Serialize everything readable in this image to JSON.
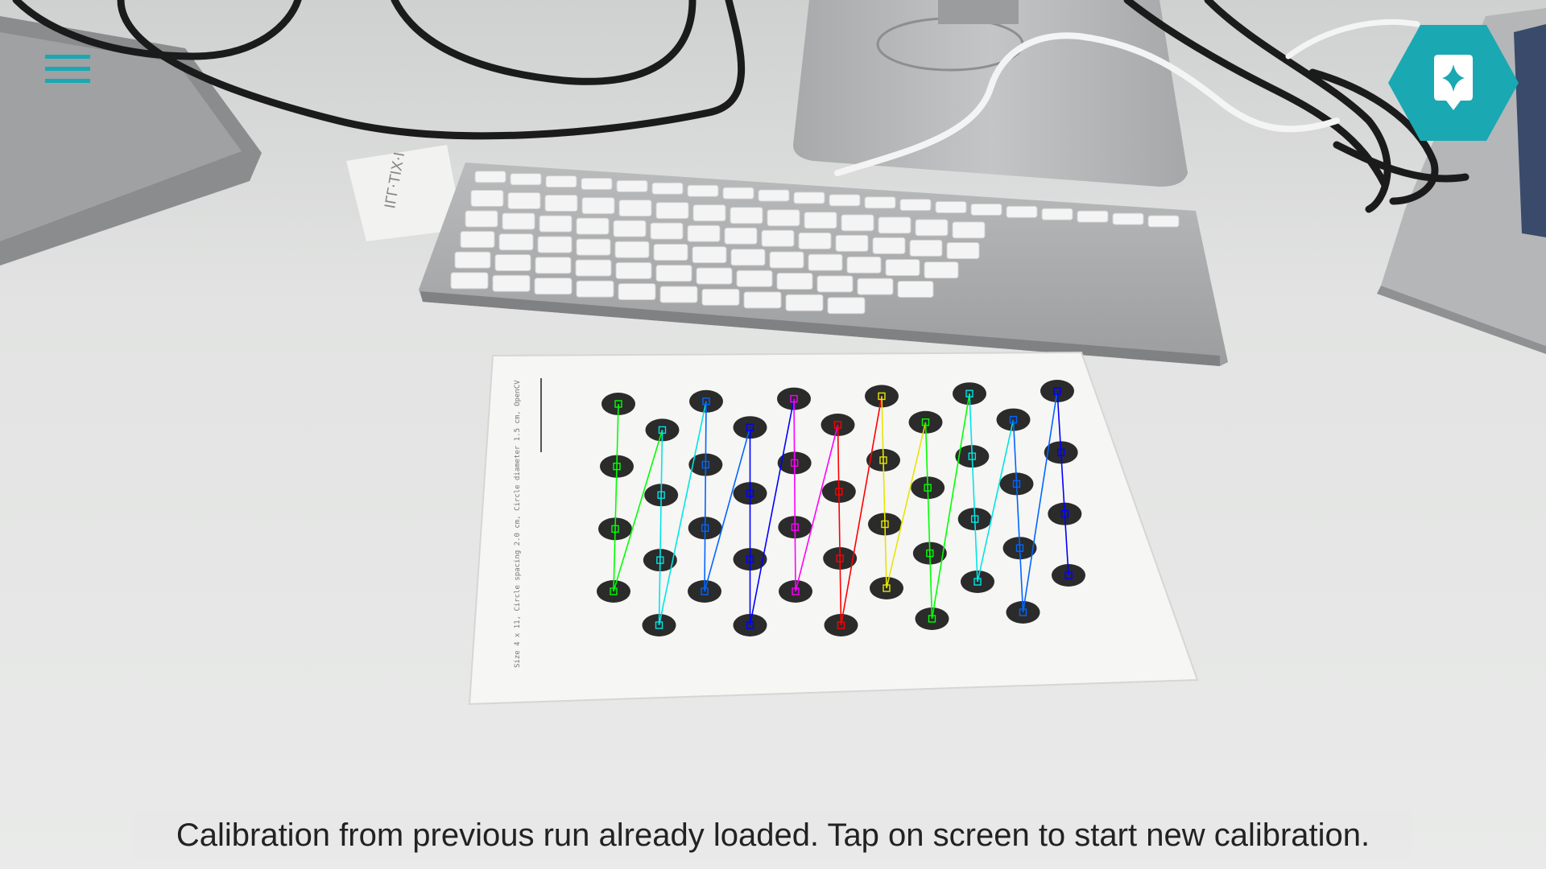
{
  "app": {
    "menu_icon": "hamburger-menu-icon",
    "feedback_icon": "sparkle-feedback-icon",
    "accent_color": "#1aa8b3",
    "status_message": "Calibration from previous run already loaded. Tap on screen to start new calibration."
  },
  "calibration_pattern": {
    "type": "asymmetric-circle-grid",
    "columns": 11,
    "rows": 4,
    "column_colors": [
      "#00ff00",
      "#00e5e5",
      "#0066ff",
      "#0000ff",
      "#ff00ff",
      "#ff0000",
      "#e6e600",
      "#00ff00",
      "#00e5e5",
      "#0066ff",
      "#0000ff"
    ]
  }
}
